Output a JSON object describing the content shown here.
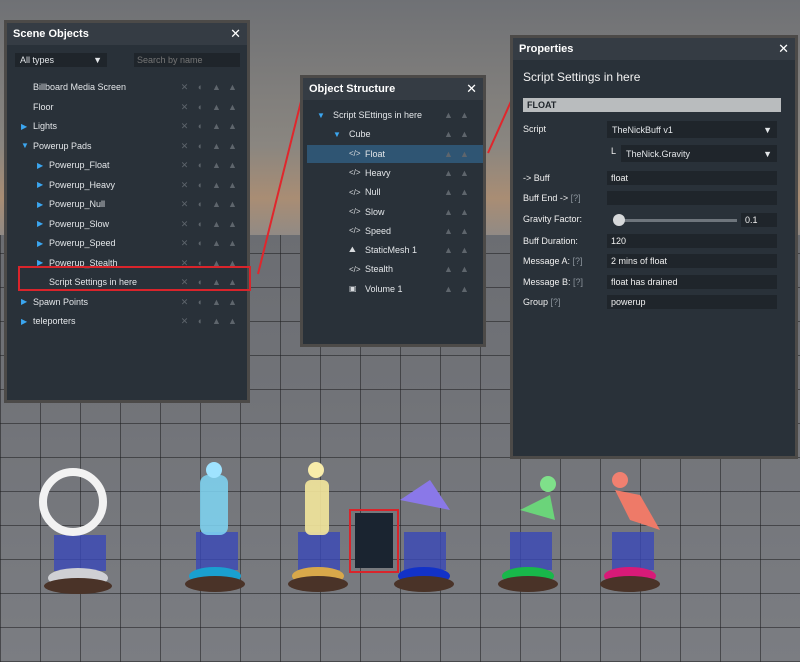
{
  "scene_objects": {
    "title": "Scene Objects",
    "close": "✕",
    "filter": "All types",
    "search_placeholder": "Search by name",
    "items": [
      {
        "label": "Billboard Media Screen",
        "expand": ""
      },
      {
        "label": "Floor",
        "expand": ""
      },
      {
        "label": "Lights",
        "expand": "▶"
      },
      {
        "label": "Powerup Pads",
        "expand": "▼"
      },
      {
        "label": "Powerup_Float",
        "expand": "▶"
      },
      {
        "label": "Powerup_Heavy",
        "expand": "▶"
      },
      {
        "label": "Powerup_Null",
        "expand": "▶"
      },
      {
        "label": "Powerup_Slow",
        "expand": "▶"
      },
      {
        "label": "Powerup_Speed",
        "expand": "▶"
      },
      {
        "label": "Powerup_Stealth",
        "expand": "▶"
      },
      {
        "label": "Script Settings in here",
        "expand": ""
      },
      {
        "label": "Spawn Points",
        "expand": "▶"
      },
      {
        "label": "teleporters",
        "expand": "▶"
      }
    ]
  },
  "object_structure": {
    "title": "Object Structure",
    "close": "✕",
    "items": [
      {
        "label": "Script SEttings in here",
        "icon": "▼"
      },
      {
        "label": "Cube",
        "icon": "▼"
      },
      {
        "label": "Float",
        "icon": "</>"
      },
      {
        "label": "Heavy",
        "icon": "</>"
      },
      {
        "label": "Null",
        "icon": "</>"
      },
      {
        "label": "Slow",
        "icon": "</>"
      },
      {
        "label": "Speed",
        "icon": "</>"
      },
      {
        "label": "StaticMesh 1",
        "icon": "⛰"
      },
      {
        "label": "Stealth",
        "icon": "</>"
      },
      {
        "label": "Volume 1",
        "icon": "▣"
      }
    ]
  },
  "properties": {
    "title": "Properties",
    "close": "✕",
    "heading": "Script Settings in here",
    "section": "FLOAT",
    "script_label": "Script",
    "script_value": "TheNickBuff v1",
    "sub_prefix": "L",
    "sub_value": "TheNick.Gravity",
    "buff_label": "-> Buff",
    "buff_value": "float",
    "buff_end_label": "Buff End ->",
    "help": "[?]",
    "buff_end_value": "",
    "gravity_label": "Gravity Factor:",
    "gravity_value": "0.1",
    "gravity_fraction": 0.0,
    "duration_label": "Buff Duration:",
    "duration_value": "120",
    "msg_a_label": "Message A:",
    "msg_a_value": "2 mins of float",
    "msg_b_label": "Message B:",
    "msg_b_value": "float has drained",
    "group_label": "Group",
    "group_value": "powerup"
  },
  "colors": {
    "accent": "#3ba6f0",
    "highlight_box": "#d9242b",
    "panel": "#293139"
  }
}
